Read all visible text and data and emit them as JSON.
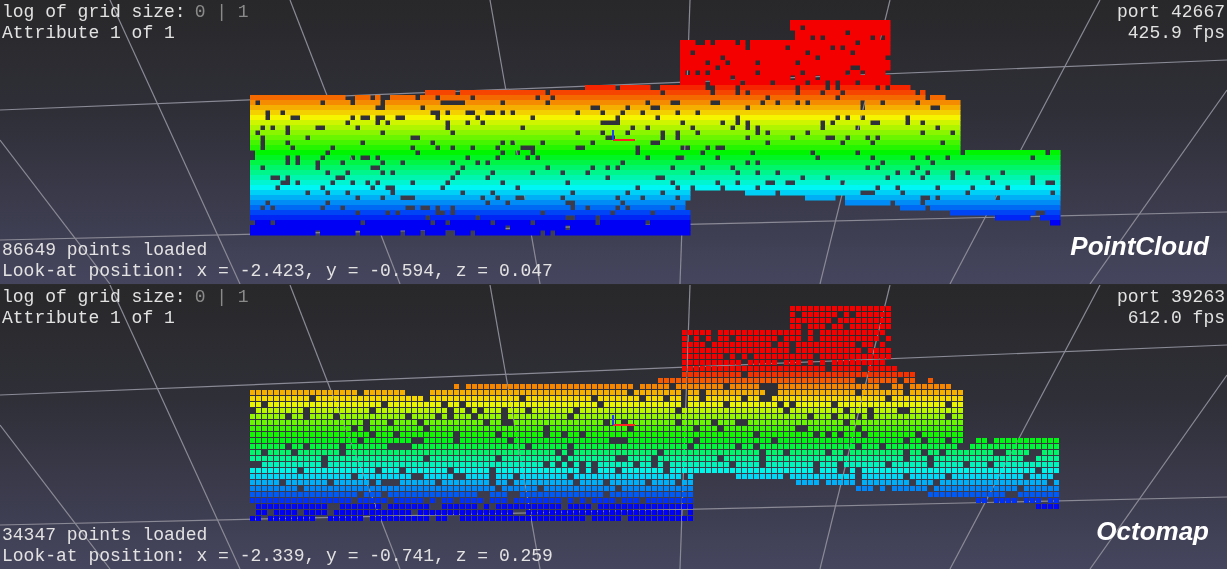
{
  "panels": [
    {
      "grid_label": "log of grid size:",
      "grid_values": "0 | 1",
      "attribute": "Attribute 1 of 1",
      "port": "port 42667",
      "fps": "425.9 fps",
      "points": "86649 points loaded",
      "look_at": "Look-at position: x = -2.423, y = -0.594, z = 0.047",
      "title": "PointCloud",
      "kind": "points"
    },
    {
      "grid_label": "log of grid size:",
      "grid_values": "0 | 1",
      "attribute": "Attribute 1 of 1",
      "port": "port 39263",
      "fps": "612.0 fps",
      "points": "34347 points loaded",
      "look_at": "Look-at position: x = -2.339, y = -0.741, z = 0.259",
      "title": "Octomap",
      "kind": "voxels"
    }
  ]
}
